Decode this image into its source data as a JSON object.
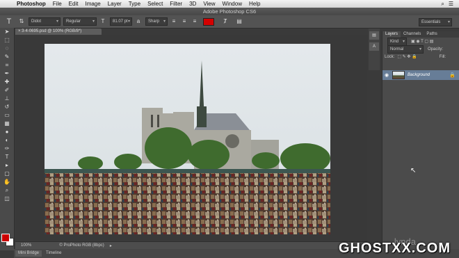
{
  "menubar": {
    "app": "Photoshop",
    "items": [
      "File",
      "Edit",
      "Image",
      "Layer",
      "Type",
      "Select",
      "Filter",
      "3D",
      "View",
      "Window",
      "Help"
    ]
  },
  "window": {
    "title": "Adobe Photoshop CS6"
  },
  "options_bar": {
    "font_family": "Didot",
    "font_style": "Regular",
    "font_size": "81.07 pt",
    "antialias": "Sharp",
    "text_color": "#d40000",
    "workspace": "Essentials"
  },
  "document": {
    "tab": "3-4-0695.psd @ 100% (RGB/8*)",
    "zoom": "100%",
    "profile": "© ProPhoto RGB (8bpc)"
  },
  "panel": {
    "tabs": [
      "Layers",
      "Channels",
      "Paths"
    ],
    "kind": "Kind",
    "blend_mode": "Normal",
    "opacity_label": "Opacity:",
    "lock_label": "Lock:",
    "fill_label": "Fill:",
    "layer_name": "Background"
  },
  "bottom_tabs": [
    "Mini Bridge",
    "Timeline"
  ],
  "watermark": {
    "main": "GHOSTXX.COM",
    "sub": "lynda"
  }
}
